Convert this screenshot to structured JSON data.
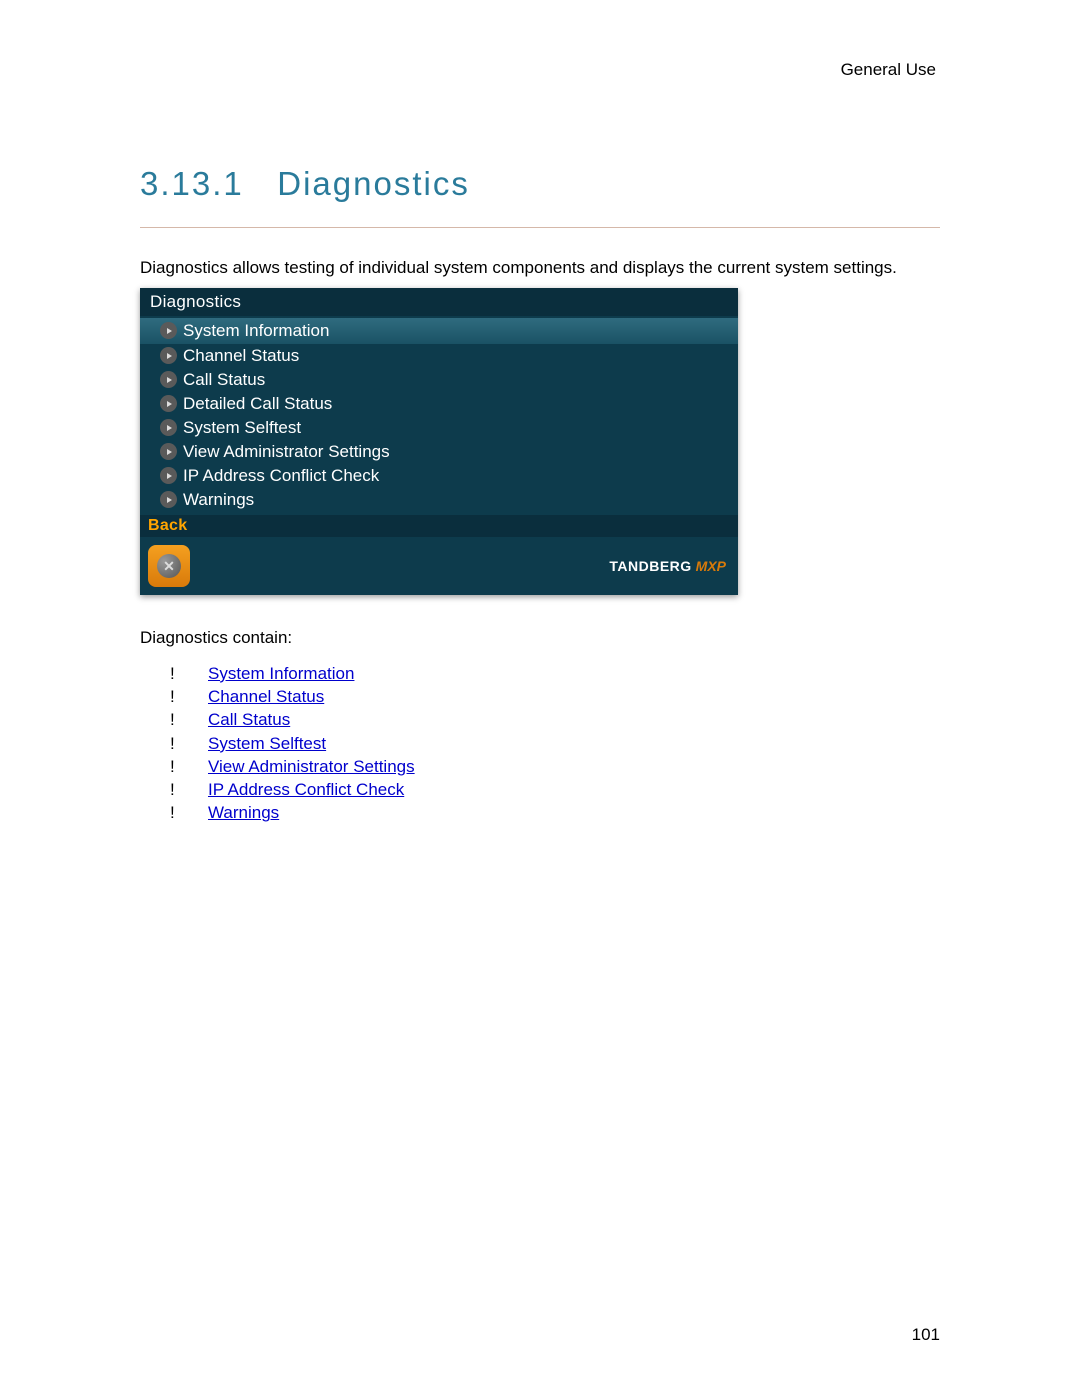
{
  "header": {
    "category": "General Use"
  },
  "section": {
    "number": "3.13.1",
    "title": "Diagnostics"
  },
  "intro": "Diagnostics allows testing of individual system components and displays the current system settings.",
  "screenshot": {
    "title": "Diagnostics",
    "items": [
      "System Information",
      "Channel Status",
      "Call Status",
      "Detailed Call Status",
      "System Selftest",
      "View Administrator Settings",
      "IP Address Conflict Check",
      "Warnings"
    ],
    "back_label": "Back",
    "logo_main": "TANDBERG",
    "logo_sub": "MXP"
  },
  "contain": {
    "title": "Diagnostics contain:",
    "items": [
      "System Information",
      "Channel Status",
      "Call Status",
      "System Selftest",
      "View Administrator Settings",
      "IP Address Conflict Check",
      "Warnings"
    ]
  },
  "page_number": "101"
}
